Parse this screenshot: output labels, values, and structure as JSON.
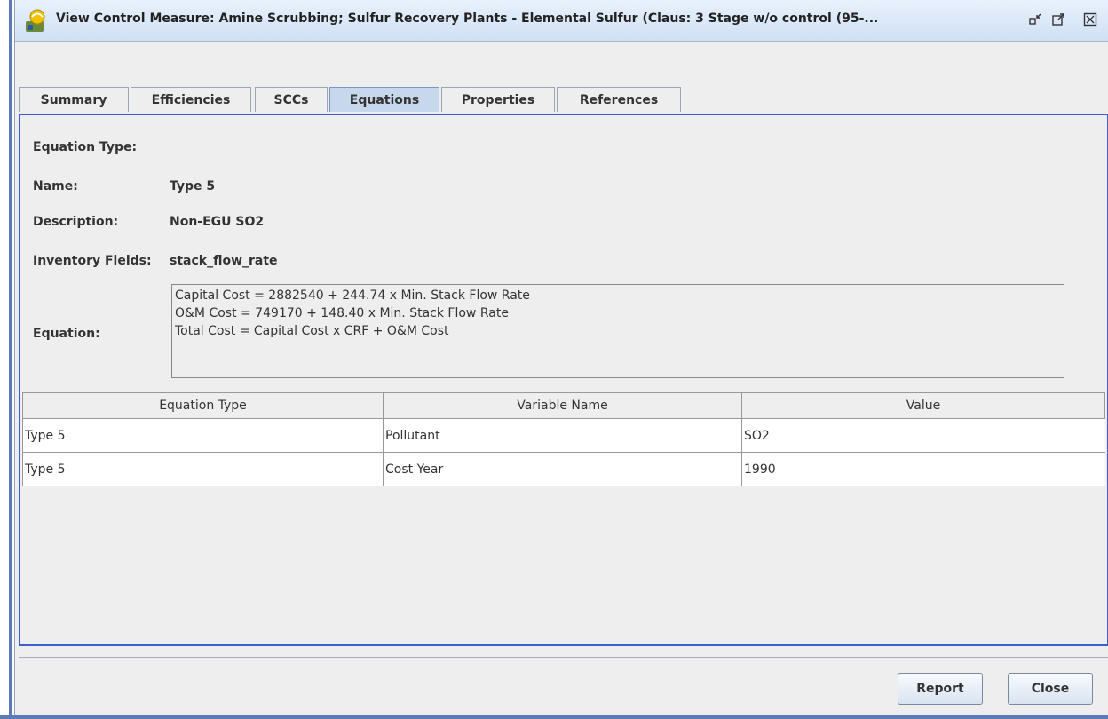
{
  "window": {
    "title": "View Control Measure: Amine Scrubbing; Sulfur Recovery Plants - Elemental Sulfur (Claus: 3 Stage w/o control (95-...",
    "icons": [
      "app-icon",
      "minimize-icon",
      "maximize-icon",
      "close-icon"
    ]
  },
  "tabs": [
    {
      "label": "Summary"
    },
    {
      "label": "Efficiencies"
    },
    {
      "label": "SCCs"
    },
    {
      "label": "Equations",
      "active": true
    },
    {
      "label": "Properties"
    },
    {
      "label": "References"
    }
  ],
  "form": {
    "equation_type_label": "Equation Type:",
    "name_label": "Name:",
    "name_value": "Type 5",
    "description_label": "Description:",
    "description_value": "Non-EGU SO2",
    "inventory_fields_label": "Inventory Fields:",
    "inventory_fields_value": "stack_flow_rate",
    "equation_label": "Equation:",
    "equation_lines": [
      "Capital Cost = 2882540 + 244.74 x Min. Stack Flow Rate",
      "O&M Cost = 749170 + 148.40 x Min. Stack Flow Rate",
      "Total Cost = Capital Cost x CRF + O&M Cost"
    ]
  },
  "table": {
    "columns": [
      "Equation Type",
      "Variable Name",
      "Value"
    ],
    "rows": [
      [
        "Type 5",
        "Pollutant",
        "SO2"
      ],
      [
        "Type 5",
        "Cost Year",
        "1990"
      ]
    ]
  },
  "buttons": {
    "report": "Report",
    "close": "Close"
  },
  "colors": {
    "accent": "#3a5fcd",
    "active_tab": "#c8d8ec"
  }
}
